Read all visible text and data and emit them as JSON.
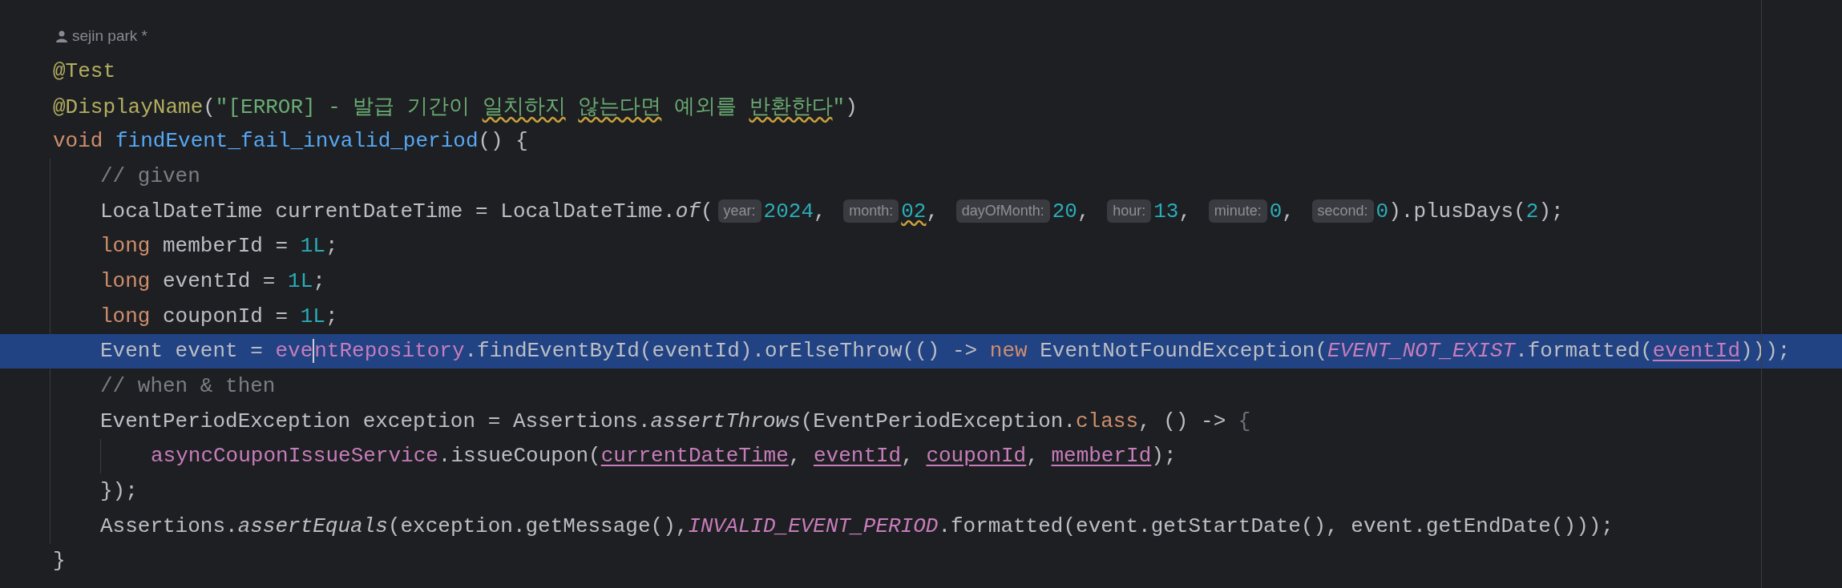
{
  "author": {
    "name": "sejin park *"
  },
  "lines": [
    {
      "selected": false,
      "tokens": [
        {
          "kind": "annotation",
          "text": "@Test"
        }
      ]
    },
    {
      "selected": false,
      "tokens": [
        {
          "kind": "annotation",
          "text": "@DisplayName"
        },
        {
          "kind": "plain",
          "text": "("
        },
        {
          "kind": "string",
          "text": "\"[ERROR] - 발급 기간이 "
        },
        {
          "kind": "typo-string",
          "text": "일치하지 "
        },
        {
          "kind": "typo-string",
          "text": "않는다면"
        },
        {
          "kind": "string",
          "text": " 예외를 "
        },
        {
          "kind": "typo-string",
          "text": "반환한다"
        },
        {
          "kind": "string",
          "text": "\""
        },
        {
          "kind": "plain",
          "text": ")"
        }
      ]
    },
    {
      "selected": false,
      "tokens": [
        {
          "kind": "keyword",
          "text": "void "
        },
        {
          "kind": "declaration",
          "text": "findEvent_fail_invalid_period"
        },
        {
          "kind": "plain",
          "text": "() {"
        }
      ],
      "children": [
        {
          "selected": false,
          "tokens": [
            {
              "kind": "comment",
              "text": "// given"
            }
          ]
        },
        {
          "selected": false,
          "tokens": [
            {
              "kind": "plain",
              "text": "LocalDateTime currentDateTime = LocalDateTime."
            },
            {
              "kind": "static-call",
              "text": "of"
            },
            {
              "kind": "plain",
              "text": "("
            },
            {
              "kind": "hint",
              "text": "year:"
            },
            {
              "kind": "number",
              "text": "2024"
            },
            {
              "kind": "plain",
              "text": ", "
            },
            {
              "kind": "hint",
              "text": "month:"
            },
            {
              "kind": "typo-number",
              "text": "02"
            },
            {
              "kind": "plain",
              "text": ", "
            },
            {
              "kind": "hint",
              "text": "dayOfMonth:"
            },
            {
              "kind": "number",
              "text": "20"
            },
            {
              "kind": "plain",
              "text": ", "
            },
            {
              "kind": "hint",
              "text": "hour:"
            },
            {
              "kind": "number",
              "text": "13"
            },
            {
              "kind": "plain",
              "text": ", "
            },
            {
              "kind": "hint",
              "text": "minute:"
            },
            {
              "kind": "number",
              "text": "0"
            },
            {
              "kind": "plain",
              "text": ", "
            },
            {
              "kind": "hint",
              "text": "second:"
            },
            {
              "kind": "number",
              "text": "0"
            },
            {
              "kind": "plain",
              "text": ").plusDays("
            },
            {
              "kind": "number",
              "text": "2"
            },
            {
              "kind": "plain",
              "text": ");"
            }
          ]
        },
        {
          "selected": false,
          "tokens": [
            {
              "kind": "keyword",
              "text": "long "
            },
            {
              "kind": "plain",
              "text": "memberId = "
            },
            {
              "kind": "number",
              "text": "1L"
            },
            {
              "kind": "plain",
              "text": ";"
            }
          ]
        },
        {
          "selected": false,
          "tokens": [
            {
              "kind": "keyword",
              "text": "long "
            },
            {
              "kind": "plain",
              "text": "eventId = "
            },
            {
              "kind": "number",
              "text": "1L"
            },
            {
              "kind": "plain",
              "text": ";"
            }
          ]
        },
        {
          "selected": false,
          "tokens": [
            {
              "kind": "keyword",
              "text": "long "
            },
            {
              "kind": "plain",
              "text": "couponId = "
            },
            {
              "kind": "number",
              "text": "1L"
            },
            {
              "kind": "plain",
              "text": ";"
            }
          ]
        },
        {
          "selected": true,
          "tokens": [
            {
              "kind": "plain",
              "text": "Event event = "
            },
            {
              "kind": "field",
              "text": "eve"
            },
            {
              "kind": "caret"
            },
            {
              "kind": "field",
              "text": "ntRepository"
            },
            {
              "kind": "plain",
              "text": ".findEventById(eventId).orElseThrow(() -> "
            },
            {
              "kind": "keyword",
              "text": "new "
            },
            {
              "kind": "plain",
              "text": "EventNotFoundException("
            },
            {
              "kind": "constant",
              "text": "EVENT_NOT_EXIST"
            },
            {
              "kind": "plain",
              "text": ".formatted("
            },
            {
              "kind": "captured",
              "text": "eventId"
            },
            {
              "kind": "plain",
              "text": ")));"
            }
          ]
        },
        {
          "selected": false,
          "tokens": [
            {
              "kind": "comment",
              "text": "// when & then"
            }
          ]
        },
        {
          "selected": false,
          "tokens": [
            {
              "kind": "plain",
              "text": "EventPeriodException exception = Assertions."
            },
            {
              "kind": "static-call",
              "text": "assertThrows"
            },
            {
              "kind": "plain",
              "text": "(EventPeriodException."
            },
            {
              "kind": "keyword",
              "text": "class"
            },
            {
              "kind": "plain",
              "text": ", () -> "
            },
            {
              "kind": "dim",
              "text": "{"
            }
          ],
          "children": [
            {
              "selected": false,
              "tokens": [
                {
                  "kind": "field",
                  "text": "asyncCouponIssueService"
                },
                {
                  "kind": "plain",
                  "text": ".issueCoupon("
                },
                {
                  "kind": "captured",
                  "text": "currentDateTime"
                },
                {
                  "kind": "plain",
                  "text": ", "
                },
                {
                  "kind": "captured",
                  "text": "eventId"
                },
                {
                  "kind": "plain",
                  "text": ", "
                },
                {
                  "kind": "captured",
                  "text": "couponId"
                },
                {
                  "kind": "plain",
                  "text": ", "
                },
                {
                  "kind": "captured",
                  "text": "memberId"
                },
                {
                  "kind": "plain",
                  "text": ");"
                }
              ]
            }
          ]
        },
        {
          "selected": false,
          "tokens": [
            {
              "kind": "plain",
              "text": "});"
            }
          ]
        },
        {
          "selected": false,
          "tokens": [
            {
              "kind": "plain",
              "text": "Assertions."
            },
            {
              "kind": "static-call",
              "text": "assertEquals"
            },
            {
              "kind": "plain",
              "text": "(exception.getMessage(),"
            },
            {
              "kind": "constant",
              "text": "INVALID_EVENT_PERIOD"
            },
            {
              "kind": "plain",
              "text": ".formatted(event.getStartDate(), event.getEndDate()));"
            }
          ]
        }
      ]
    },
    {
      "selected": false,
      "tokens": [
        {
          "kind": "plain",
          "text": "}"
        }
      ]
    }
  ]
}
